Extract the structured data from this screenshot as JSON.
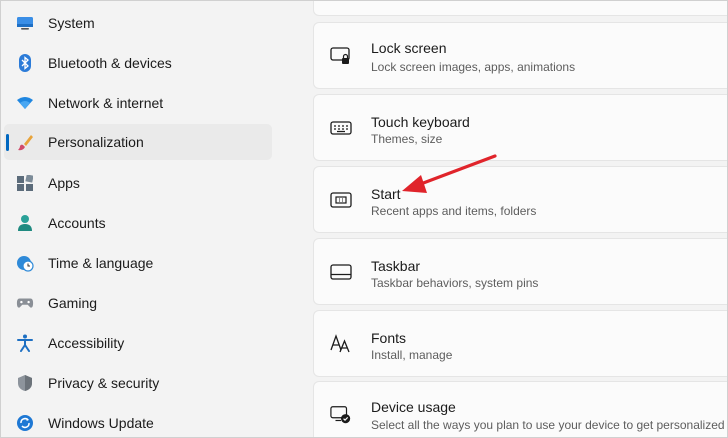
{
  "sidebar": {
    "items": [
      {
        "label": "System",
        "icon": "monitor-icon"
      },
      {
        "label": "Bluetooth & devices",
        "icon": "bluetooth-icon"
      },
      {
        "label": "Network & internet",
        "icon": "wifi-icon"
      },
      {
        "label": "Personalization",
        "icon": "brush-icon",
        "selected": true
      },
      {
        "label": "Apps",
        "icon": "apps-icon"
      },
      {
        "label": "Accounts",
        "icon": "person-icon"
      },
      {
        "label": "Time & language",
        "icon": "clock-globe-icon"
      },
      {
        "label": "Gaming",
        "icon": "gamepad-icon"
      },
      {
        "label": "Accessibility",
        "icon": "accessibility-icon"
      },
      {
        "label": "Privacy & security",
        "icon": "shield-icon"
      },
      {
        "label": "Windows Update",
        "icon": "update-icon"
      }
    ]
  },
  "main": {
    "cards": [
      {
        "title": "Lock screen",
        "subtitle": "Lock screen images, apps, animations",
        "icon": "lock-screen-icon"
      },
      {
        "title": "Touch keyboard",
        "subtitle": "Themes, size",
        "icon": "keyboard-icon"
      },
      {
        "title": "Start",
        "subtitle": "Recent apps and items, folders",
        "icon": "start-menu-icon"
      },
      {
        "title": "Taskbar",
        "subtitle": "Taskbar behaviors, system pins",
        "icon": "taskbar-icon"
      },
      {
        "title": "Fonts",
        "subtitle": "Install, manage",
        "icon": "fonts-icon"
      },
      {
        "title": "Device usage",
        "subtitle": "Select all the ways you plan to use your device to get personalized",
        "icon": "device-usage-icon"
      }
    ]
  },
  "annotation": {
    "arrow_color": "#e0242b"
  },
  "colors": {
    "accent": "#0067c0",
    "background": "#f3f3f3",
    "card": "#fbfbfb"
  }
}
